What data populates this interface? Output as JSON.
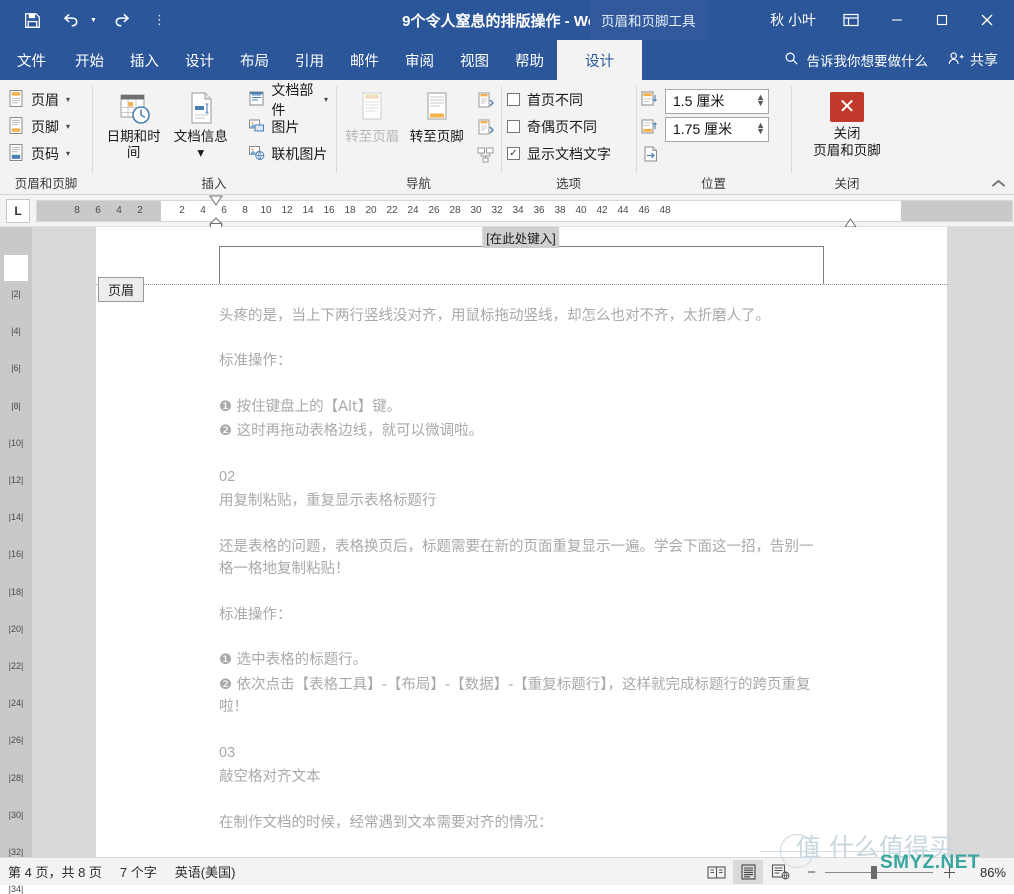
{
  "titlebar": {
    "quick_access": [
      {
        "name": "save-button",
        "icon": "save-icon"
      },
      {
        "name": "undo-button",
        "icon": "undo-icon",
        "has_caret": true
      },
      {
        "name": "redo-button",
        "icon": "redo-icon"
      },
      {
        "name": "customize-qat-button",
        "icon": "dropdown-dots-icon",
        "label": "⋮"
      }
    ],
    "document_title": "9个令人窒息的排版操作",
    "app_name": "Word",
    "title_separator": "-",
    "contextual_tab": "页眉和页脚工具",
    "user_name": "秋 小叶",
    "ribbon_display_options": "ribbon-display-options-icon",
    "minimize": "─",
    "maximize": "□",
    "close": "✕"
  },
  "tabs": [
    {
      "label": "文件",
      "active": false
    },
    {
      "label": "开始",
      "active": false
    },
    {
      "label": "插入",
      "active": false
    },
    {
      "label": "设计",
      "active": false
    },
    {
      "label": "布局",
      "active": false
    },
    {
      "label": "引用",
      "active": false
    },
    {
      "label": "邮件",
      "active": false
    },
    {
      "label": "审阅",
      "active": false
    },
    {
      "label": "视图",
      "active": false
    },
    {
      "label": "帮助",
      "active": false
    },
    {
      "label": "设计",
      "active": true
    }
  ],
  "tellme": {
    "label": "告诉我你想要做什么",
    "icon": "search-icon"
  },
  "share": {
    "label": "共享",
    "icon": "share-person-icon"
  },
  "ribbon": {
    "groups": [
      {
        "title": "页眉和页脚",
        "buttons": [
          {
            "label": "页眉",
            "icon": "header-icon",
            "caret": "▾"
          },
          {
            "label": "页脚",
            "icon": "footer-icon",
            "caret": "▾"
          },
          {
            "label": "页码",
            "icon": "page-number-icon",
            "caret": "▾"
          }
        ]
      },
      {
        "title": "插入",
        "big_buttons": [
          {
            "label": "日期和时间",
            "icon": "calendar-clock-icon"
          },
          {
            "label": "文档信息",
            "icon": "document-info-icon",
            "caret": "▾"
          }
        ],
        "small_buttons": [
          {
            "label": "文档部件",
            "icon": "quick-parts-icon",
            "caret": "▾"
          },
          {
            "label": "图片",
            "icon": "picture-icon"
          },
          {
            "label": "联机图片",
            "icon": "online-picture-icon"
          }
        ]
      },
      {
        "title": "导航",
        "big_buttons": [
          {
            "label": "转至页眉",
            "icon": "goto-header-icon",
            "disabled": true
          },
          {
            "label": "转至页脚",
            "icon": "goto-footer-icon",
            "disabled": false
          }
        ],
        "icon_buttons": [
          {
            "name": "previous-section-icon"
          },
          {
            "name": "next-section-icon"
          },
          {
            "name": "link-to-previous-icon"
          }
        ]
      },
      {
        "title": "选项",
        "checkboxes": [
          {
            "label": "首页不同",
            "checked": false
          },
          {
            "label": "奇偶页不同",
            "checked": false
          },
          {
            "label": "显示文档文字",
            "checked": true
          }
        ]
      },
      {
        "title": "位置",
        "spinners": [
          {
            "icon": "header-from-top-icon",
            "value": "1.5 厘米"
          },
          {
            "icon": "footer-from-bottom-icon",
            "value": "1.75 厘米"
          }
        ],
        "extra_button": {
          "name": "insert-alignment-tab-icon"
        }
      },
      {
        "title": "关闭",
        "close_button": {
          "icon": "close-x-icon",
          "line1": "关闭",
          "line2": "页眉和页脚"
        }
      }
    ],
    "collapse_icon": "chevron-up-icon"
  },
  "ruler": {
    "tab_stop_marker": "L",
    "horizontal_left_gray": [
      "8",
      "6",
      "4",
      "2"
    ],
    "horizontal_ticks": [
      "2",
      "4",
      "6",
      "8",
      "10",
      "12",
      "14",
      "16",
      "18",
      "20",
      "22",
      "24",
      "26",
      "28",
      "30",
      "32",
      "34",
      "36",
      "38"
    ],
    "horizontal_right_gray": [
      "40",
      "42",
      "44",
      "46",
      "48"
    ],
    "vertical_ticks": [
      "2",
      "4",
      "6",
      "8",
      "10",
      "12",
      "14",
      "16",
      "18",
      "20",
      "22",
      "24",
      "26",
      "28",
      "30",
      "32",
      "34"
    ]
  },
  "document": {
    "header_placeholder": "[在此处键入]",
    "header_tag": "页眉",
    "paragraphs": [
      {
        "text": "头疼的是，当上下两行竖线没对齐，用鼠标拖动竖线，却怎么也对不齐，太折磨人了。",
        "style": "first"
      },
      {
        "text": "标准操作：",
        "style": "gap"
      },
      {
        "text": "❶ 按住键盘上的【Alt】键。",
        "style": "gap"
      },
      {
        "text": "❷ 这时再拖动表格边线，就可以微调啦。",
        "style": "tight"
      },
      {
        "text": "02",
        "style": "gap"
      },
      {
        "text": "用复制粘贴，重复显示表格标题行",
        "style": "tight"
      },
      {
        "text": "还是表格的问题，表格换页后，标题需要在新的页面重复显示一遍。学会下面这一招，告别一格一格地复制粘贴！",
        "style": "gap"
      },
      {
        "text": "标准操作：",
        "style": "gap"
      },
      {
        "text": "❶ 选中表格的标题行。",
        "style": "gap"
      },
      {
        "text": "❷ 依次点击【表格工具】-【布局】-【数据】-【重复标题行】，这样就完成标题行的跨页重复啦！",
        "style": "tight"
      },
      {
        "text": "03",
        "style": "gap"
      },
      {
        "text": "敲空格对齐文本",
        "style": "tight"
      },
      {
        "text": "在制作文档的时候，经常遇到文本需要对齐的情况：",
        "style": "gap"
      }
    ]
  },
  "statusbar": {
    "page_info": "第 4 页，共 8 页",
    "word_count": "7 个字",
    "language": "英语(美国)",
    "views": [
      {
        "name": "read-mode-icon",
        "active": false
      },
      {
        "name": "print-layout-icon",
        "active": true
      },
      {
        "name": "web-layout-icon",
        "active": false
      }
    ],
    "zoom_out": "−",
    "zoom_in": "＋",
    "zoom_level": "86%"
  },
  "watermark": {
    "chinese": "值 什么值得买",
    "english": "SMYZ.NET"
  },
  "colors": {
    "brand_blue": "#2b579a",
    "contextual_tab": "#31599c",
    "ribbon_bg": "#f3f3f3",
    "close_red": "#c0392b",
    "doc_text": "#a9a9a9",
    "watermark_teal": "#3aa6a0"
  }
}
